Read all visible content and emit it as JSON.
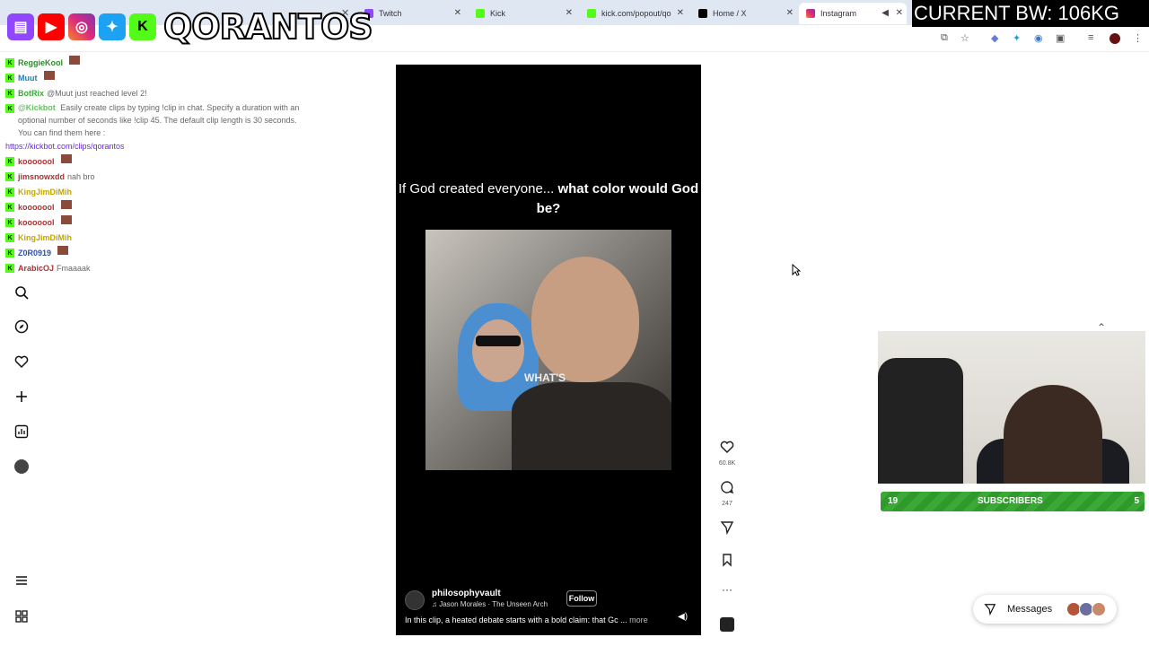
{
  "browser": {
    "tabs": [
      {
        "label": "Twitch",
        "icon": "twitch-icon"
      },
      {
        "label": "Kick",
        "icon": "kick-icon"
      },
      {
        "label": "kick.com/popout/qo",
        "icon": "kick-icon"
      },
      {
        "label": "Home / X",
        "icon": "x-icon"
      },
      {
        "label": "Instagram",
        "icon": "instagram-icon"
      }
    ],
    "active_tab": "Instagram"
  },
  "overlay": {
    "brand": "QORANTOS",
    "bandwidth": "CURRENT BW: 106KG",
    "subscribers_left": "19",
    "subscribers_label": "SUBSCRIBERS",
    "subscribers_right": "5"
  },
  "chat": [
    {
      "user": "ReggieKool",
      "text": ""
    },
    {
      "user": "Muut",
      "text": ""
    },
    {
      "user": "BotRix",
      "text": "@Muut just reached level 2!"
    },
    {
      "user": "@Kickbot",
      "text": "Easily create clips by typing !clip in chat. Specify a duration with an optional number of seconds like !clip 45. The default clip length is 30 seconds. You can find them here :"
    },
    {
      "user": "",
      "text": "https://kickbot.com/clips/qorantos",
      "link": true
    },
    {
      "user": "kooooool",
      "text": ""
    },
    {
      "user": "jimsnowxdd",
      "text": "nah bro"
    },
    {
      "user": "KingJimDiMih",
      "text": ""
    },
    {
      "user": "kooooool",
      "text": ""
    },
    {
      "user": "kooooool",
      "text": ""
    },
    {
      "user": "KingJimDiMih",
      "text": ""
    },
    {
      "user": "Z0R0919",
      "text": ""
    },
    {
      "user": "ArabicOJ",
      "text": "Fmaaaak"
    }
  ],
  "reel": {
    "caption_plain": "If God created everyone...",
    "caption_bold": "what color would God be?",
    "subtitle": "WHAT'S",
    "author": "philosophyvault",
    "song": "Jason Morales · The Unseen Arch",
    "follow_label": "Follow",
    "description": "In this clip, a heated debate starts with a bold claim: that Gc ...",
    "more_label": "more"
  },
  "actions": {
    "likes": "60.8K",
    "comments": "247"
  },
  "messages": {
    "label": "Messages"
  },
  "colors": {
    "kick_green": "#53fc18",
    "sub_bar_green": "#3aa935",
    "link_purple": "#6b2bd9"
  }
}
